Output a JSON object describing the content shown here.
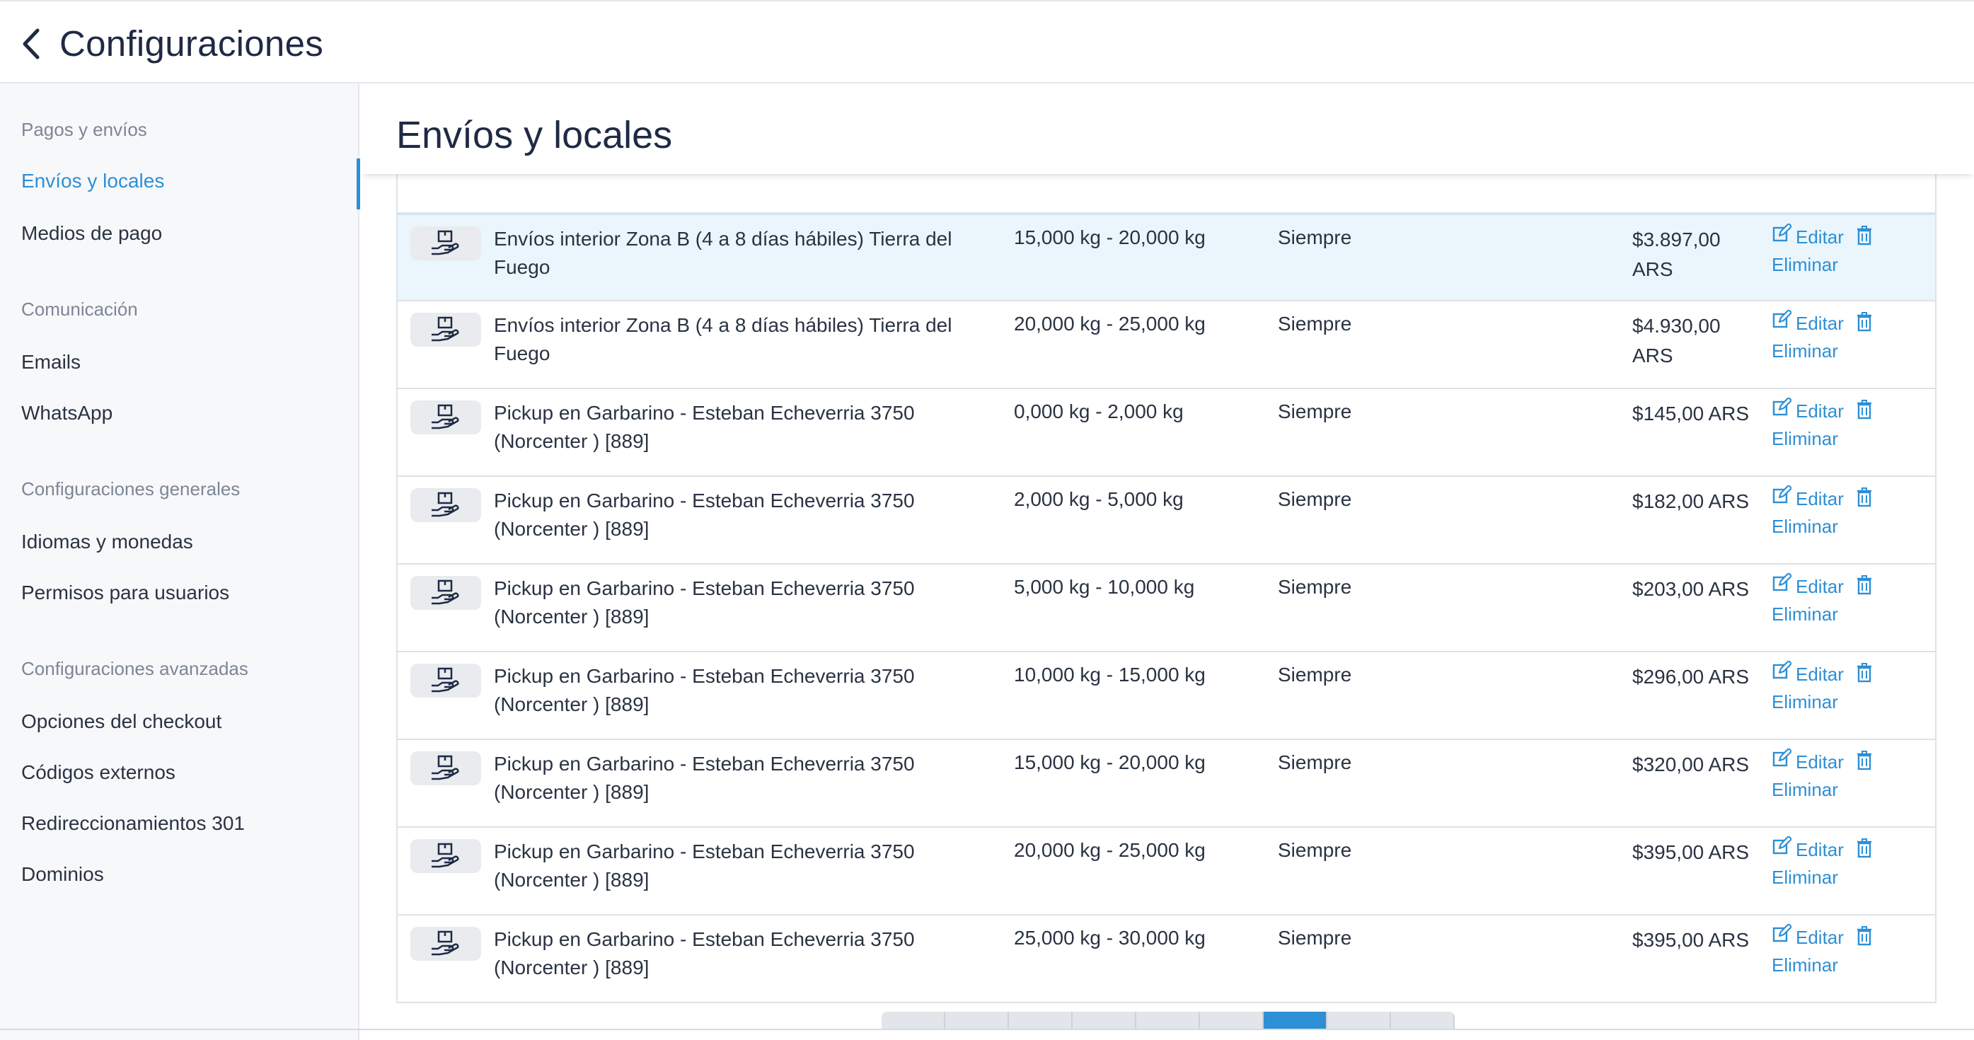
{
  "topbar": {
    "title": "Configuraciones"
  },
  "sidebar": {
    "sections": [
      {
        "title": "Pagos y envíos",
        "items": [
          "Envíos y locales",
          "Medios de pago"
        ]
      },
      {
        "title": "Comunicación",
        "items": [
          "Emails",
          "WhatsApp"
        ]
      },
      {
        "title": "Configuraciones generales",
        "items": [
          "Idiomas y monedas",
          "Permisos para usuarios"
        ]
      },
      {
        "title": "Configuraciones avanzadas",
        "items": [
          "Opciones del checkout",
          "Códigos externos",
          "Redireccionamientos 301",
          "Dominios"
        ]
      }
    ],
    "active_item": "Envíos y locales"
  },
  "main": {
    "title": "Envíos y locales"
  },
  "actions": {
    "edit": "Editar",
    "delete": "Eliminar"
  },
  "rows": [
    {
      "name": "Envíos interior Zona B (4 a 8 días hábiles) Tierra del Fuego",
      "weight": "",
      "when": "",
      "price": "ARS",
      "partial": true
    },
    {
      "name": "Envíos interior Zona B (4 a 8 días hábiles) Tierra del Fuego",
      "weight": "15,000 kg - 20,000 kg",
      "when": "Siempre",
      "price": "$3.897,00 ARS",
      "highlight": true
    },
    {
      "name": "Envíos interior Zona B (4 a 8 días hábiles) Tierra del Fuego",
      "weight": "20,000 kg - 25,000 kg",
      "when": "Siempre",
      "price": "$4.930,00 ARS"
    },
    {
      "name": "Pickup en Garbarino - Esteban Echeverria 3750 (Norcenter ) [889]",
      "weight": "0,000 kg - 2,000 kg",
      "when": "Siempre",
      "price": "$145,00 ARS"
    },
    {
      "name": "Pickup en Garbarino - Esteban Echeverria 3750 (Norcenter ) [889]",
      "weight": "2,000 kg - 5,000 kg",
      "when": "Siempre",
      "price": "$182,00 ARS"
    },
    {
      "name": "Pickup en Garbarino - Esteban Echeverria 3750 (Norcenter ) [889]",
      "weight": "5,000 kg - 10,000 kg",
      "when": "Siempre",
      "price": "$203,00 ARS"
    },
    {
      "name": "Pickup en Garbarino - Esteban Echeverria 3750 (Norcenter ) [889]",
      "weight": "10,000 kg - 15,000 kg",
      "when": "Siempre",
      "price": "$296,00 ARS"
    },
    {
      "name": "Pickup en Garbarino - Esteban Echeverria 3750 (Norcenter ) [889]",
      "weight": "15,000 kg - 20,000 kg",
      "when": "Siempre",
      "price": "$320,00 ARS"
    },
    {
      "name": "Pickup en Garbarino - Esteban Echeverria 3750 (Norcenter ) [889]",
      "weight": "20,000 kg - 25,000 kg",
      "when": "Siempre",
      "price": "$395,00 ARS"
    },
    {
      "name": "Pickup en Garbarino - Esteban Echeverria 3750 (Norcenter ) [889]",
      "weight": "25,000 kg - 30,000 kg",
      "when": "Siempre",
      "price": "$395,00 ARS"
    }
  ],
  "icons": {
    "row": "hand-package-icon",
    "edit": "edit-icon",
    "delete": "trash-icon",
    "back": "chevron-left-icon"
  },
  "colors": {
    "accent": "#2d8fd5",
    "highlight_row": "#eaf6fc",
    "sidebar_bg": "#f7f8fa"
  },
  "pagination": {
    "current": 7,
    "total": 9
  }
}
